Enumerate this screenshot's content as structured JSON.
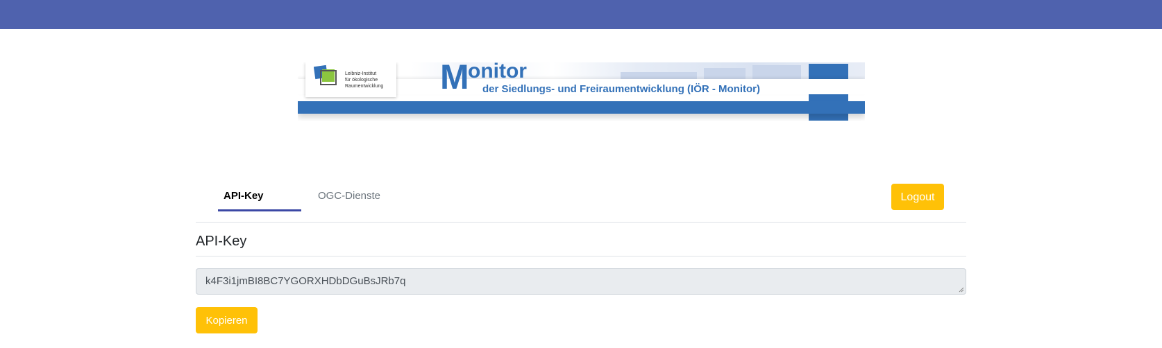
{
  "colors": {
    "topbar": "#4f62ae",
    "brand_blue": "#3371b8",
    "accent_yellow": "#ffc107",
    "tab_underline": "#3b48a5"
  },
  "banner": {
    "logo_text": "Leibniz-Institut\nfür ökologische\nRaumentwicklung",
    "title_initial": "M",
    "title_rest": "onitor",
    "subtitle": "der Siedlungs- und Freiraumentwicklung  (IÖR - Monitor)"
  },
  "tabs": [
    {
      "label": "API-Key",
      "active": true
    },
    {
      "label": "OGC-Dienste",
      "active": false
    }
  ],
  "logout_label": "Logout",
  "section": {
    "title": "API-Key",
    "api_key_value": "k4F3i1jmBI8BC7YGORXHDbDGuBsJRb7q"
  },
  "copy_label": "Kopieren"
}
